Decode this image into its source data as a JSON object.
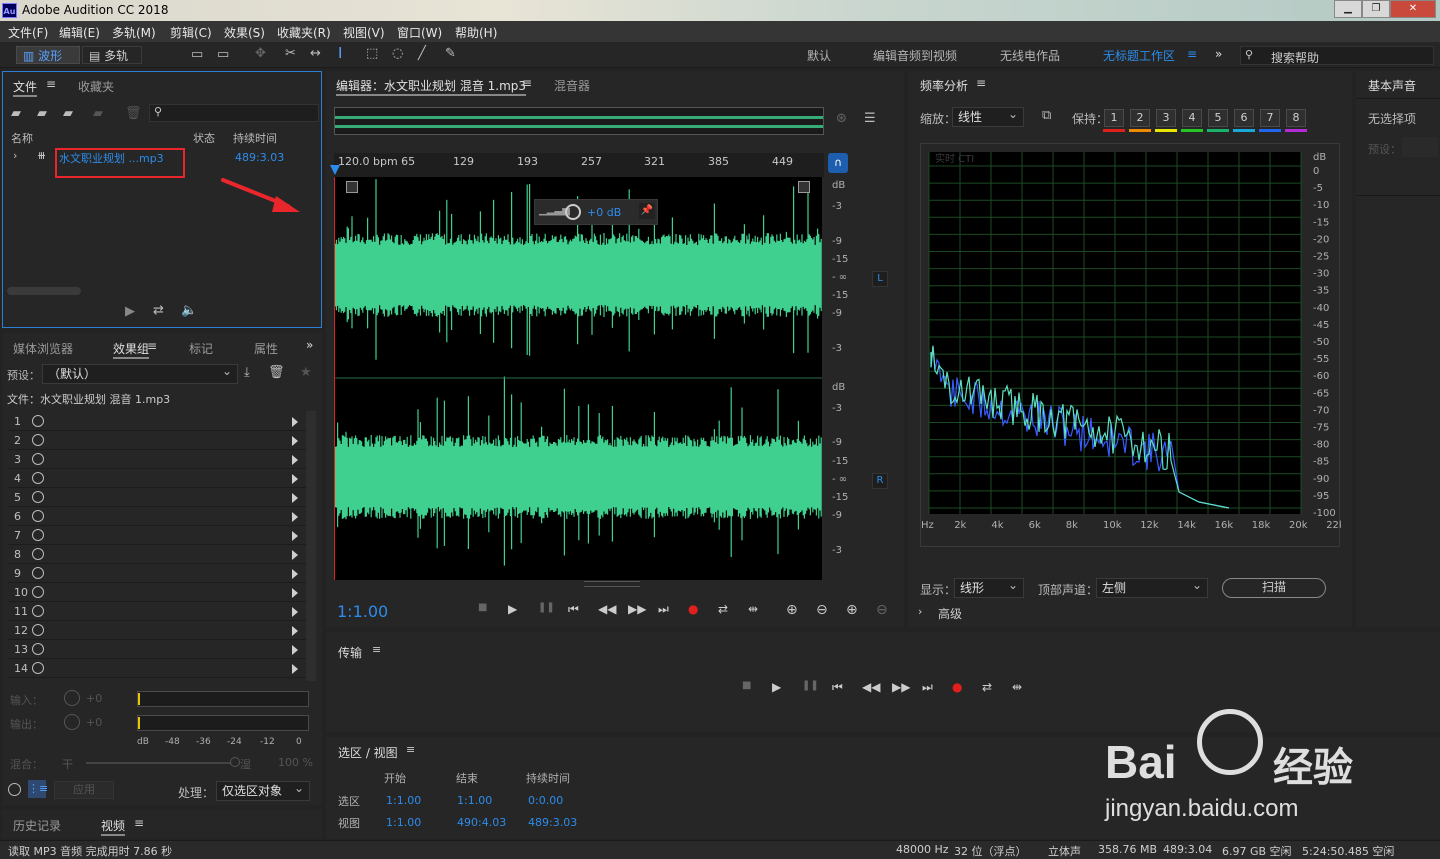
{
  "app": {
    "title": "Adobe Audition CC 2018",
    "logo": "Au"
  },
  "menu": [
    "文件(F)",
    "编辑(E)",
    "多轨(M)",
    "剪辑(C)",
    "效果(S)",
    "收藏夹(R)",
    "视图(V)",
    "窗口(W)",
    "帮助(H)"
  ],
  "toolbar": {
    "waveform": "波形",
    "multitrack": "多轨"
  },
  "workspaces": [
    "默认",
    "编辑音频到视频",
    "无线电作品",
    "无标题工作区"
  ],
  "search_placeholder": "搜索帮助",
  "files": {
    "tab_files": "文件",
    "tab_favorites": "收藏夹",
    "col_name": "名称",
    "col_status": "状态",
    "col_duration": "持续时间",
    "file_name": "水文职业规划 ...mp3",
    "file_duration": "489:3.03"
  },
  "effects": {
    "tabs": [
      "媒体浏览器",
      "效果组",
      "标记",
      "属性"
    ],
    "preset_label": "预设：",
    "preset_value": "（默认）",
    "file_label": "文件：水文职业规划 混音 1.mp3",
    "rows": [
      "1",
      "2",
      "3",
      "4",
      "5",
      "6",
      "7",
      "8",
      "9",
      "10",
      "11",
      "12",
      "13",
      "14"
    ],
    "input_label": "输入：",
    "output_label": "输出：",
    "db_zero": "+0",
    "meter_ticks": [
      "dB",
      "-48",
      "-36",
      "-24",
      "-12",
      "0"
    ],
    "mix_label": "混合：",
    "mix_dry": "干",
    "mix_wet": "湿",
    "mix_pct": "100 %",
    "apply": "应用",
    "process_label": "处理：",
    "process_value": "仅选区对象"
  },
  "bottom_tabs": {
    "history": "历史记录",
    "video": "视频"
  },
  "editor": {
    "tab": "编辑器：水文职业规划 混音 1.mp3",
    "mixer": "混音器",
    "ruler": [
      "120.0 bpm 65",
      "129",
      "193",
      "257",
      "321",
      "385",
      "449"
    ],
    "hud_db": "+0 dB",
    "db_ticks_top": [
      "dB",
      "-3",
      "-9",
      "-15",
      "- ∞",
      "-15",
      "-9",
      "-3"
    ],
    "db_ticks_bottom": [
      "dB",
      "-3",
      "-9",
      "-15",
      "- ∞",
      "-15",
      "-9",
      "-3"
    ],
    "ch_left": "L",
    "ch_right": "R",
    "time": "1:1.00"
  },
  "freq": {
    "title": "频率分析",
    "zoom_label": "缩放：",
    "zoom_value": "线性",
    "hold_label": "保持：",
    "holds": [
      "1",
      "2",
      "3",
      "4",
      "5",
      "6",
      "7",
      "8"
    ],
    "hold_colors": [
      "#e0201c",
      "#f08a00",
      "#e6e600",
      "#26c526",
      "#18b26a",
      "#1aa8d8",
      "#2266ee",
      "#b12bd6"
    ],
    "cti_label": "实时 CTI",
    "db_axis": [
      "dB",
      "0",
      "-5",
      "-10",
      "-15",
      "-20",
      "-25",
      "-30",
      "-35",
      "-40",
      "-45",
      "-50",
      "-55",
      "-60",
      "-65",
      "-70",
      "-75",
      "-80",
      "-85",
      "-90",
      "-95",
      "-100"
    ],
    "hz_axis": [
      "Hz",
      "2k",
      "4k",
      "6k",
      "8k",
      "10k",
      "12k",
      "14k",
      "16k",
      "18k",
      "20k",
      "22k"
    ],
    "display_label": "显示：",
    "display_value": "线形",
    "top_channel_label": "顶部声道：",
    "top_channel_value": "左侧",
    "scan": "扫描",
    "advanced": "高级"
  },
  "essential": {
    "title": "基本声音",
    "no_selection": "无选择项",
    "preset": "预设："
  },
  "transport": {
    "title": "传输"
  },
  "selection": {
    "title": "选区 / 视图",
    "col_start": "开始",
    "col_end": "结束",
    "col_duration": "持续时间",
    "row_sel": "选区",
    "row_view": "视图",
    "sel_start": "1:1.00",
    "sel_end": "1:1.00",
    "sel_dur": "0:0.00",
    "view_start": "1:1.00",
    "view_end": "490:4.03",
    "view_dur": "489:3.03"
  },
  "status": {
    "left": "读取 MP3 音频 完成用时 7.86 秒",
    "rate": "48000 Hz",
    "bits": "32 位（浮点）",
    "channels": "立体声",
    "size": "358.76 MB",
    "duration": "489:3.04",
    "free": "6.97 GB 空闲",
    "free_time": "5:24:50.485 空闲"
  },
  "watermark": {
    "brand": "Bai",
    "brand2": "经验",
    "url": "jingyan.baidu.com"
  }
}
